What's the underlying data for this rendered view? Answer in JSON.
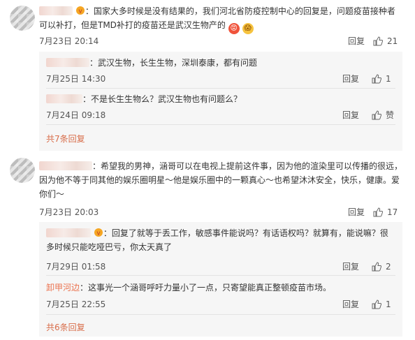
{
  "comments": [
    {
      "text_line1": "：国家大多时候是没有结果的，我们河北省防疫控制中心的回复是，问题疫苗接种者",
      "text_line2": "可以补打，但是TMD补打的疫苗还是武汉生物产的",
      "time": "7月23日 20:14",
      "reply_label": "回复",
      "like_count": "21",
      "replies": [
        {
          "text": "：武汉生物，长生生物，深圳泰康，都有问题",
          "time": "7月25日 14:30",
          "reply_label": "回复",
          "like_count": "1"
        },
        {
          "text": "：不是长生生物么？武汉生物也有问题么？",
          "time": "7月24日 09:18",
          "reply_label": "回复",
          "like_count": "赞"
        }
      ],
      "more": "共7条回复"
    },
    {
      "text_line1": "：希望我的男神，涵哥可以在电视上提前这件事，因为他的渲染里可以传播的很远，",
      "text_line2": "因为他不等于同其他的娱乐圈明星～他是娱乐圈中的一颗真心～也希望沐沐安全，快乐，健康。爱",
      "text_line3": "你们～",
      "time": "7月23日 20:03",
      "reply_label": "回复",
      "like_count": "17",
      "replies": [
        {
          "text_line1": "：回复了就等于丢工作，敏感事件能说吗？有话语权吗？就算有，能说嘛？很",
          "text_line2": "多时候只能吃哑巴亏，你太天真了",
          "time": "7月29日 01:58",
          "reply_label": "回复",
          "like_count": "2"
        },
        {
          "handle": "卸甲河边",
          "text": "：这事光一个涵哥呼吁力量小了一点，只寄望能真正整顿疫苗市场。",
          "time": "7月25日 22:55",
          "reply_label": "回复",
          "like_count": "1"
        }
      ],
      "more": "共6条回复"
    }
  ]
}
